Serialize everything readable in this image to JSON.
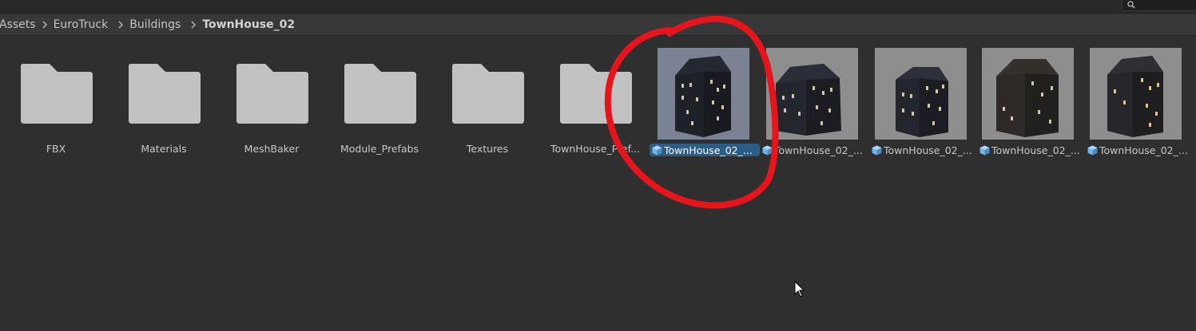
{
  "search": {
    "placeholder": ""
  },
  "breadcrumb": [
    "Assets",
    "EuroTruck",
    "Buildings",
    "TownHouse_02"
  ],
  "folders": [
    {
      "label": "FBX"
    },
    {
      "label": "Materials"
    },
    {
      "label": "MeshBaker"
    },
    {
      "label": "Module_Prefabs"
    },
    {
      "label": "Textures"
    },
    {
      "label": "TownHouse_Pref..."
    }
  ],
  "prefabs": [
    {
      "label": "TownHouse_02_...",
      "selected": true
    },
    {
      "label": "TownHouse_02_...",
      "selected": false
    },
    {
      "label": "TownHouse_02_...",
      "selected": false
    },
    {
      "label": "TownHouse_02_...",
      "selected": false
    },
    {
      "label": "TownHouse_02_...",
      "selected": false
    }
  ],
  "colors": {
    "background": "#2f2f2f",
    "selection": "#2c5d87",
    "annotation": "#e8141c",
    "prefab_icon": "#6fb6e8"
  },
  "icons": {
    "folder": "folder-icon",
    "prefab": "prefab-cube-icon",
    "search": "search-icon"
  }
}
